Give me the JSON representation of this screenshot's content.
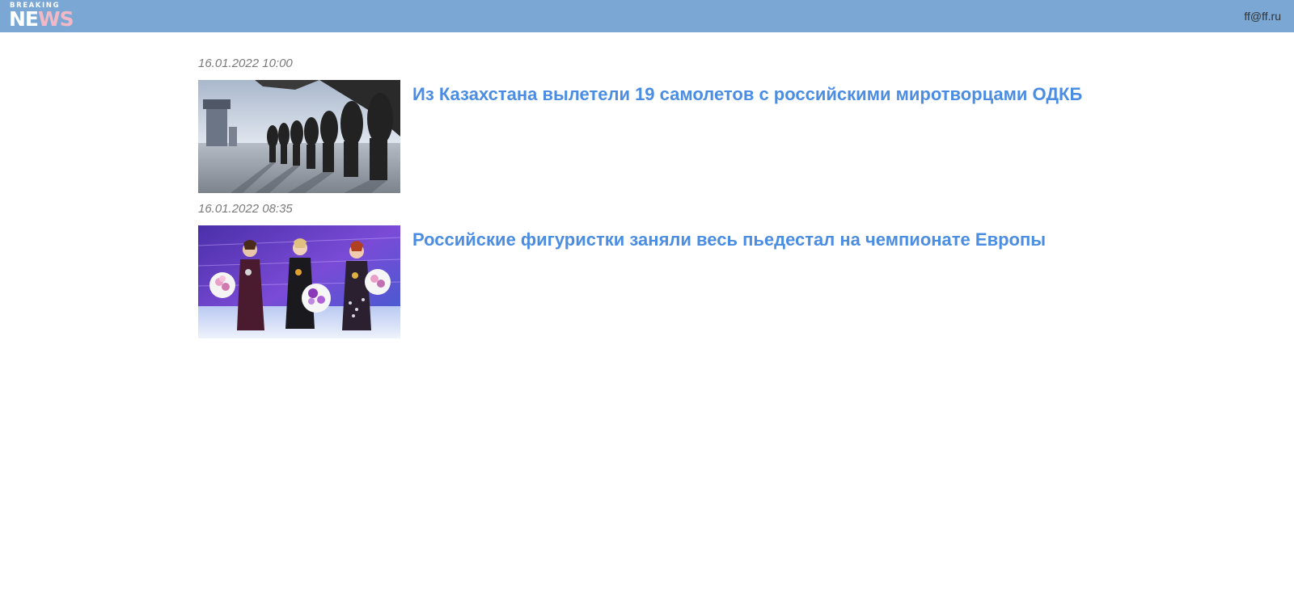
{
  "header": {
    "logo_top": "BREAKING",
    "logo_main_a": "NE",
    "logo_main_b": "WS",
    "user_email": "ff@ff.ru"
  },
  "articles": [
    {
      "date": "16.01.2022 10:00",
      "title": "Из Казахстана вылетели 19 самолетов с российскими миротворцами ОДКБ",
      "image": "soldiers-boarding-aircraft"
    },
    {
      "date": "16.01.2022 08:35",
      "title": "Российские фигуристки заняли весь пьедестал на чемпионате Европы",
      "image": "figure-skaters-podium"
    }
  ],
  "colors": {
    "header_bg": "#7aa7d3",
    "headline": "#4a8de2",
    "date": "#7a7a7a"
  }
}
